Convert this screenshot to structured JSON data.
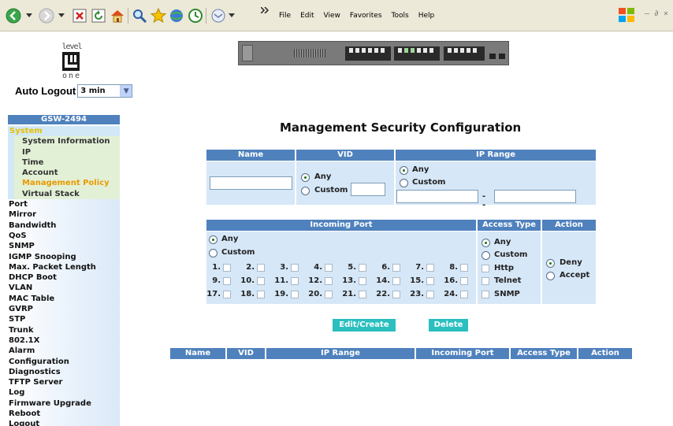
{
  "browser": {
    "menu": [
      "File",
      "Edit",
      "View",
      "Favorites",
      "Tools",
      "Help"
    ],
    "toolbar_icons": [
      "back-icon",
      "forward-icon",
      "stop-icon",
      "refresh-icon",
      "home-icon",
      "search-icon",
      "favorites-icon",
      "media-icon",
      "history-icon",
      "mail-icon",
      "more-icon"
    ],
    "window_controls": "– ∂ ×"
  },
  "logo": {
    "top": "level",
    "bottom": "one"
  },
  "auto_logout": {
    "label": "Auto Logout",
    "value": "3 min"
  },
  "nav": {
    "header": "GSW-2494",
    "system": "System",
    "system_items": [
      "System Information",
      "IP",
      "Time",
      "Account",
      "Management Policy",
      "Virtual Stack"
    ],
    "active_item": "Management Policy",
    "items": [
      "Port",
      "Mirror",
      "Bandwidth",
      "QoS",
      "SNMP",
      "IGMP Snooping",
      "Max. Packet Length",
      "DHCP Boot",
      "VLAN",
      "MAC Table",
      "GVRP",
      "STP",
      "Trunk",
      "802.1X",
      "Alarm",
      "Configuration",
      "Diagnostics",
      "TFTP Server",
      "Log",
      "Firmware Upgrade",
      "Reboot",
      "Logout"
    ]
  },
  "page_title": "Management Security Configuration",
  "form1": {
    "headers": {
      "name": "Name",
      "vid": "VID",
      "ip_range": "IP Range"
    },
    "name_value": "",
    "vid": {
      "any": "Any",
      "custom": "Custom",
      "selected": "Any",
      "custom_value": ""
    },
    "ip": {
      "any": "Any",
      "custom": "Custom",
      "selected": "Any",
      "from": "",
      "separator": "--",
      "to": ""
    }
  },
  "form2": {
    "headers": {
      "incoming_port": "Incoming Port",
      "access_type": "Access Type",
      "action": "Action"
    },
    "port": {
      "any": "Any",
      "custom": "Custom",
      "selected": "Any"
    },
    "ports": [
      "1.",
      "2.",
      "3.",
      "4.",
      "5.",
      "6.",
      "7.",
      "8.",
      "9.",
      "10.",
      "11.",
      "12.",
      "13.",
      "14.",
      "15.",
      "16.",
      "17.",
      "18.",
      "19.",
      "20.",
      "21.",
      "22.",
      "23.",
      "24."
    ],
    "access": {
      "any": "Any",
      "custom": "Custom",
      "selected": "Any",
      "types": [
        "Http",
        "Telnet",
        "SNMP"
      ]
    },
    "action": {
      "deny": "Deny",
      "accept": "Accept",
      "selected": "Deny"
    }
  },
  "buttons": {
    "edit_create": "Edit/Create",
    "delete": "Delete"
  },
  "list_table": {
    "headers": [
      "Name",
      "VID",
      "IP Range",
      "Incoming Port",
      "Access Type",
      "Action"
    ]
  }
}
